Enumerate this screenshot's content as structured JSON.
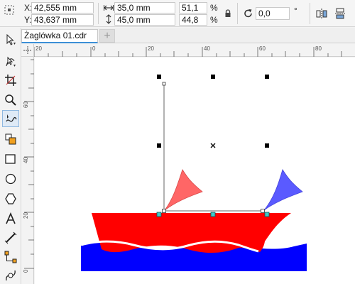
{
  "position": {
    "x_label": "X:",
    "x_value": "42,555 mm",
    "y_label": "Y:",
    "y_value": "43,637 mm"
  },
  "size": {
    "width_value": "35,0 mm",
    "height_value": "45,0 mm"
  },
  "scale": {
    "x_value": "51,1",
    "y_value": "44,8",
    "unit": "%"
  },
  "rotation": {
    "value": "0,0",
    "unit": "°"
  },
  "document_tab": {
    "label": "Żaglówka 01.cdr",
    "add_label": "+"
  },
  "ruler_h": {
    "ticks": [
      "20",
      "0",
      "20",
      "40",
      "60",
      "80"
    ]
  },
  "ruler_v": {
    "ticks": [
      "60",
      "40",
      "20",
      "0"
    ]
  },
  "colors": {
    "hull": "#ff0000",
    "water": "#0000ff",
    "sail_left": "#ff6666",
    "sail_right": "#5a5aff",
    "tab_accent": "#3c8fd6",
    "handle": "#40c8c8"
  },
  "icons": [
    "position-icon",
    "width-icon",
    "height-icon",
    "lock-icon",
    "rotate-icon",
    "mirror-horizontal-icon",
    "mirror-vertical-icon"
  ],
  "tools": [
    "pick-tool-icon",
    "shape-tool-icon",
    "crop-tool-icon",
    "zoom-tool-icon",
    "freehand-tool-icon",
    "smart-fill-tool-icon",
    "rectangle-tool-icon",
    "ellipse-tool-icon",
    "polygon-tool-icon",
    "text-tool-icon",
    "dimension-tool-icon",
    "connector-tool-icon",
    "blend-tool-icon"
  ]
}
